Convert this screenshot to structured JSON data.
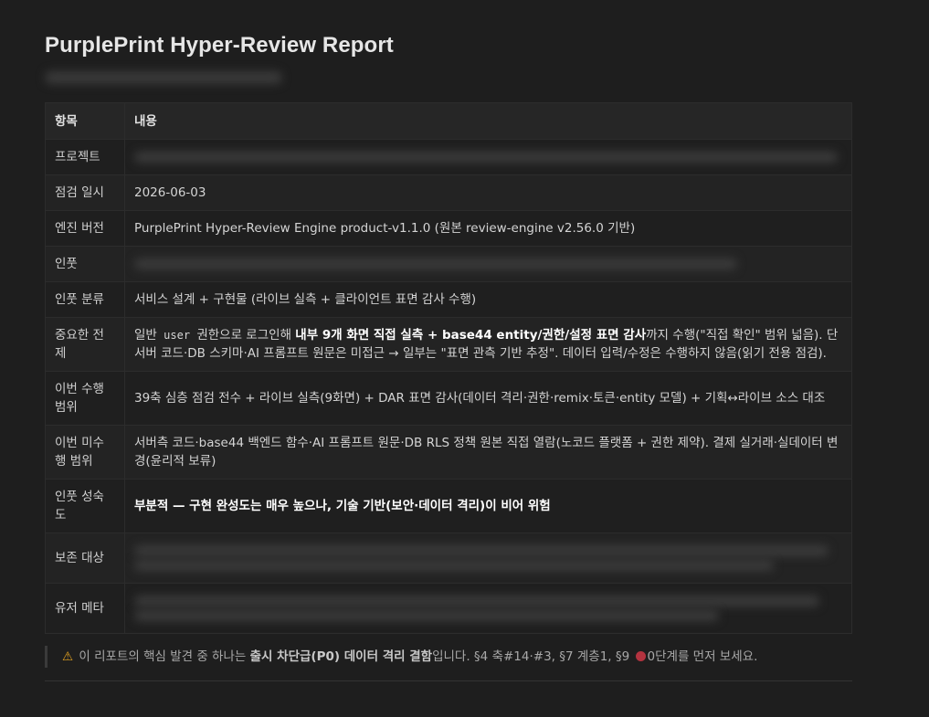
{
  "title": "PurplePrint Hyper-Review Report",
  "table": {
    "headers": [
      "항목",
      "내용"
    ],
    "rows": {
      "project": {
        "key": "프로젝트"
      },
      "date": {
        "key": "점검 일시",
        "value": "2026-06-03"
      },
      "engine": {
        "key": "엔진 버전",
        "value": "PurplePrint Hyper-Review Engine product-v1.1.0 (원본 review-engine v2.56.0 기반)"
      },
      "input": {
        "key": "인풋"
      },
      "input_class": {
        "key": "인풋 분류",
        "value": "서비스 설계 + 구현물 (라이브 실측 + 클라이언트 표면 감사 수행)"
      },
      "premise": {
        "key": "중요한 전제",
        "p1": "일반 ",
        "code": "user",
        "p2": " 권한으로 로그인해 ",
        "strong": "내부 9개 화면 직접 실측 + base44 entity/권한/설정 표면 감사",
        "p3": "까지 수행(\"직접 확인\" 범위 넓음). 단 서버 코드·DB 스키마·AI 프롬프트 원문은 미접근 → 일부는 \"표면 관측 기반 추정\". 데이터 입력/수정은 수행하지 않음(읽기 전용 점검)."
      },
      "scope": {
        "key": "이번 수행 범위",
        "value": "39축 심층 점검 전수 + 라이브 실측(9화면) + DAR 표면 감사(데이터 격리·권한·remix·토큰·entity 모델) + 기획↔라이브 소스 대조"
      },
      "out_of_scope": {
        "key": "이번 미수행 범위",
        "value": "서버측 코드·base44 백엔드 함수·AI 프롬프트 원문·DB RLS 정책 원본 직접 열람(노코드 플랫폼 + 권한 제약). 결제 실거래·실데이터 변경(윤리적 보류)"
      },
      "maturity": {
        "key": "인풋 성숙도",
        "p1": "부분적 — ",
        "strong": "구현 완성도는 매우 높으나, 기술 기반(보안·데이터 격리)이 비어 위험"
      },
      "preserve": {
        "key": "보존 대상"
      },
      "user_meta": {
        "key": "유저 메타"
      }
    }
  },
  "note": {
    "icon": "warning-icon",
    "p1": "이 리포트의 핵심 발견 중 하나는 ",
    "strong": "출시 차단급(P0) 데이터 격리 결함",
    "p2": "입니다. §4 축#14·#3, §7 계층1, §9 ",
    "p3": "0단계를 먼저 보세요.",
    "dot_color": "#b3333f"
  }
}
